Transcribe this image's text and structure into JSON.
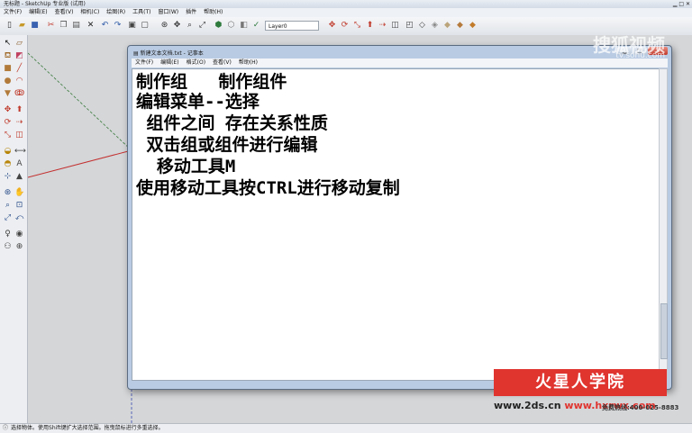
{
  "sketchup": {
    "window_title": "无标题 - SketchUp 专业版 (试用)",
    "menu": [
      "文件(F)",
      "编辑(E)",
      "查看(V)",
      "相机(C)",
      "绘图(R)",
      "工具(T)",
      "窗口(W)",
      "插件",
      "帮助(H)"
    ],
    "layer_value": "Layer0",
    "status_text": "选择物体。使用Shift键扩大选择范围。拖曳鼠标进行多重选择。"
  },
  "notepad": {
    "title": "新建文本文档.txt - 记事本",
    "menu": [
      "文件(F)",
      "编辑(E)",
      "格式(O)",
      "查看(V)",
      "帮助(H)"
    ],
    "lines": [
      "制作组   制作组件",
      "编辑菜单--选择",
      " 组件之间 存在关系性质",
      " 双击组或组件进行编辑",
      "  移动工具M",
      "使用移动工具按CTRL进行移动复制"
    ]
  },
  "watermark": {
    "top_logo": "搜狐视频",
    "top_url": "tv.sohu.com",
    "banner": "火星人学院",
    "url_prefix": "www.2ds.cn",
    "url_main": "www.hxrwx.com",
    "hotline": "免费热线:400-025-8883"
  }
}
